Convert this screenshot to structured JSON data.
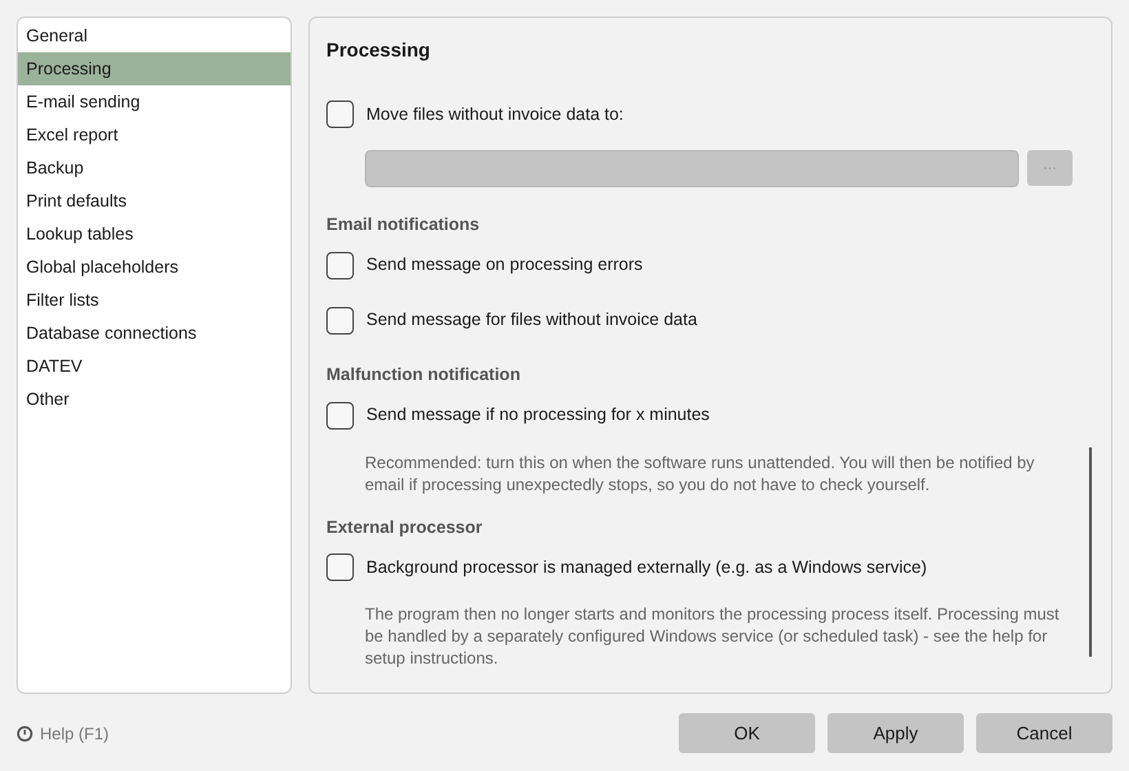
{
  "sidebar": {
    "items": [
      {
        "label": "General",
        "selected": false
      },
      {
        "label": "Processing",
        "selected": true
      },
      {
        "label": "E-mail sending",
        "selected": false
      },
      {
        "label": "Excel report",
        "selected": false
      },
      {
        "label": "Backup",
        "selected": false
      },
      {
        "label": "Print defaults",
        "selected": false
      },
      {
        "label": "Lookup tables",
        "selected": false
      },
      {
        "label": "Global placeholders",
        "selected": false
      },
      {
        "label": "Filter lists",
        "selected": false
      },
      {
        "label": "Database connections",
        "selected": false
      },
      {
        "label": "DATEV",
        "selected": false
      },
      {
        "label": "Other",
        "selected": false
      }
    ]
  },
  "panel": {
    "title": "Processing",
    "sections": [
      {
        "items": [
          {
            "kind": "checkbox",
            "label": "Move files without invoice data to:",
            "checked": false
          },
          {
            "kind": "path",
            "disabled": true,
            "browse_label": "···"
          }
        ]
      },
      {
        "heading": "Email notifications",
        "items": [
          {
            "kind": "checkbox",
            "label": "Send message on processing errors",
            "checked": false
          },
          {
            "kind": "checkbox",
            "label": "Send message for files without invoice data",
            "checked": false
          }
        ]
      },
      {
        "heading": "Malfunction notification",
        "items": [
          {
            "kind": "checkbox",
            "label": "Send message if no processing for x minutes",
            "checked": false
          },
          {
            "kind": "note",
            "text": "Recommended: turn this on when the software runs unattended. You will then be notified by email if processing unexpectedly stops, so you do not have to check yourself."
          }
        ]
      },
      {
        "heading": "External processor",
        "items": [
          {
            "kind": "checkbox",
            "label": "Background processor is managed externally (e.g. as a Windows service)",
            "checked": false
          },
          {
            "kind": "note",
            "text": "The program then no longer starts and monitors the processing process itself. Processing must be handled by a separately configured Windows service (or scheduled task) - see the help for setup instructions."
          }
        ]
      }
    ]
  },
  "help": {
    "label": "Help (F1)"
  },
  "buttons": [
    "OK",
    "Apply",
    "Cancel"
  ]
}
